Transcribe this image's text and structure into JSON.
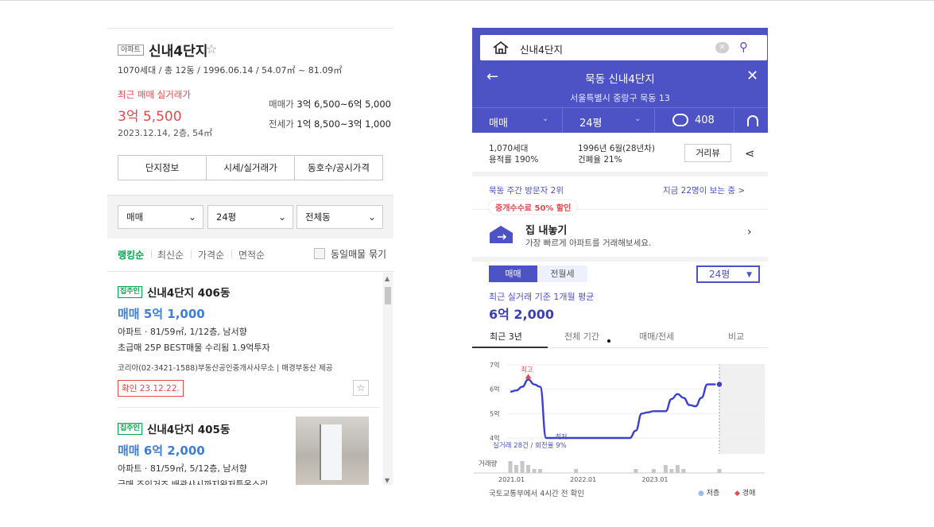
{
  "left": {
    "type_tag": "아파트",
    "name": "신내4단지",
    "meta": "1070세대 / 총 12동 / 1996.06.14 / 54.07㎡ ~ 81.09㎡",
    "recent_label": "최근 매매 실거래가",
    "recent_price": "3억 5,500",
    "recent_date": "2023.12.14, 2층, 54㎡",
    "sale_range_label": "매매가",
    "sale_range": "3억 6,500~6억 5,000",
    "jeonse_range_label": "전세가",
    "jeonse_range": "1억 8,500~3억 1,000",
    "tabs": [
      "단지정보",
      "시세/실거래가",
      "동호수/공시가격"
    ],
    "filters": [
      "매매",
      "24평",
      "전체동"
    ],
    "sorts": [
      "랭킹순",
      "최신순",
      "가격순",
      "면적순"
    ],
    "group_label": "동일매물 묶기",
    "listings": [
      {
        "badge": "집주인",
        "name": "신내4단지 406동",
        "price": "매매 5억 1,000",
        "spec": "아파트 · 81/59㎡, 1/12층, 남서향",
        "desc": "초급매 25P BEST매물 수리됨 1.9억투자",
        "agent": "코리아(02-3421-1588)부동산공인중개사사무소 | 매경부동산 제공",
        "confirm": "확인 23.12.22."
      },
      {
        "badge": "집주인",
        "name": "신내4단지 405동",
        "price": "매매 6억 2,000",
        "spec": "아파트 · 81/59㎡, 5/12층, 남서향",
        "desc": "급매 조인거즈 배관샤시까지완저틀옥스리"
      }
    ]
  },
  "right": {
    "search_text": "신내4단지",
    "title": "묵동 신내4단지",
    "address": "서울특별시 중랑구 묵동 13",
    "tabs": {
      "trade": "매매",
      "size": "24평",
      "comments": "408"
    },
    "info": {
      "households": "1,070세대",
      "far": "용적률 190%",
      "built": "1996년 6월(28년차)",
      "bcr": "건폐율 21%"
    },
    "distance_button": "거리뷰",
    "visit_rank": "묵동 주간 방문자 2위",
    "viewing_now": "지금 22명이 보는 중 >",
    "promo": "중개수수료 50% 할인",
    "sell_title": "집 내놓기",
    "sell_sub": "가장 빠르게 아파트를 거래해보세요.",
    "toggle_on": "매매",
    "toggle_off": "전월세",
    "size_select": "24평",
    "avg_label": "최근 실거래 기준 1개월 평균",
    "avg_price": "6억 2,000",
    "period_tabs": [
      "최근 3년",
      "전체 기간",
      "매매/전세",
      "비교"
    ],
    "footer_note": "국토교통부에서 4시간 전 확인",
    "legend_low": "저층",
    "legend_auction": "경매"
  },
  "chart_data": {
    "type": "line",
    "y_unit": "억",
    "y_ticks": [
      "7억",
      "6억",
      "5억",
      "4억"
    ],
    "ylim": [
      4,
      7
    ],
    "x_ticks": [
      "2021.01",
      "2022.01",
      "2023.01"
    ],
    "annotations": {
      "high": "최고",
      "low": "최저",
      "summary": "실거래 28건 / 회전율 9%"
    },
    "volume_label": "거래량",
    "series": [
      {
        "x": [
          "2021.01",
          "2021.02",
          "2021.03",
          "2021.04",
          "2021.05",
          "2021.06",
          "2021.07",
          "2021.08",
          "2021.09",
          "2021.10",
          "2021.11",
          "2021.12",
          "2022.01",
          "2022.02",
          "2022.03",
          "2022.04",
          "2022.05",
          "2022.06",
          "2022.07",
          "2022.08",
          "2022.09",
          "2022.10",
          "2022.11",
          "2022.12",
          "2023.01",
          "2023.02",
          "2023.03",
          "2023.04",
          "2023.05",
          "2023.06",
          "2023.07",
          "2023.08",
          "2023.09",
          "2023.10",
          "2023.11",
          "2023.12"
        ],
        "values": [
          5.9,
          5.95,
          6.1,
          6.4,
          6.2,
          6.1,
          4.0,
          4.0,
          4.0,
          4.0,
          4.0,
          4.0,
          4.0,
          4.0,
          4.0,
          4.0,
          4.0,
          4.0,
          4.0,
          4.0,
          4.0,
          4.3,
          5.0,
          5.05,
          5.1,
          5.1,
          5.1,
          5.6,
          5.8,
          5.65,
          5.35,
          5.3,
          5.65,
          6.2,
          6.2,
          6.2
        ]
      }
    ],
    "volume": [
      3,
      2,
      3,
      2,
      1,
      1,
      0,
      0,
      0,
      0,
      0,
      1,
      0,
      0,
      0,
      0,
      0,
      0,
      0,
      0,
      0,
      1,
      0,
      0,
      1,
      0,
      2,
      1,
      2,
      1,
      0,
      0,
      0,
      0,
      0,
      1
    ]
  }
}
